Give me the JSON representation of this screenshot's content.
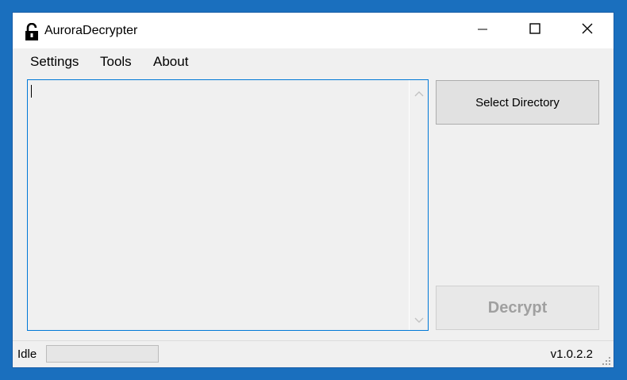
{
  "window": {
    "title": "AuroraDecrypter",
    "icon": "lock-open-icon"
  },
  "title_buttons": {
    "minimize": "minimize-icon",
    "maximize": "maximize-icon",
    "close": "close-icon"
  },
  "menu": {
    "items": [
      {
        "label": "Settings"
      },
      {
        "label": "Tools"
      },
      {
        "label": "About"
      }
    ]
  },
  "main": {
    "text_value": "",
    "select_directory_label": "Select Directory",
    "decrypt_label": "Decrypt"
  },
  "status": {
    "text": "Idle",
    "progress": 0,
    "version": "v1.0.2.2"
  },
  "colors": {
    "desktop": "#1a6fbe",
    "accent": "#0078d7",
    "disabled_text": "#a0a0a0"
  }
}
